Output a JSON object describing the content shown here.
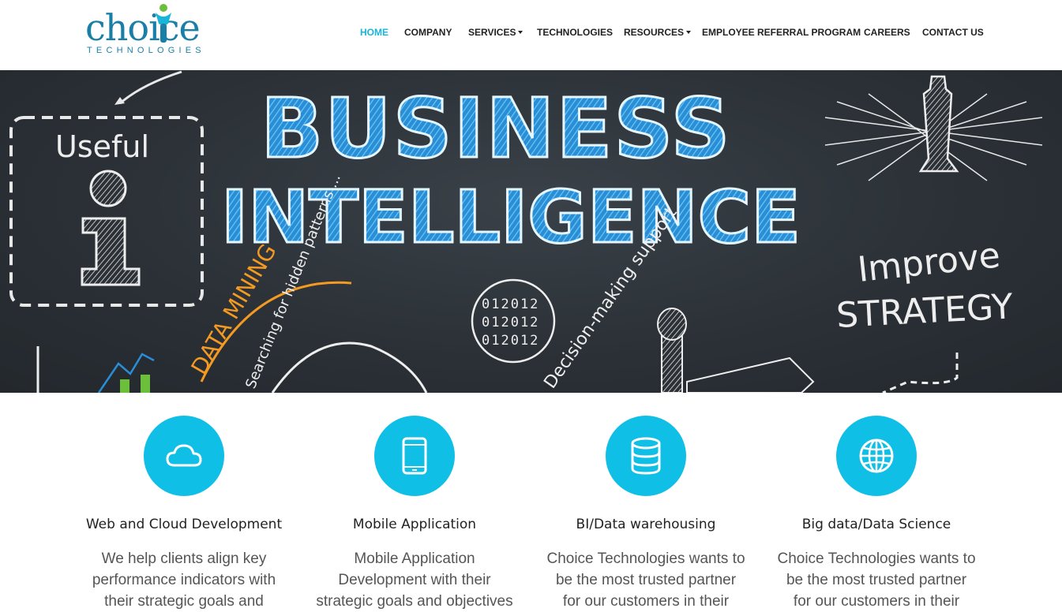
{
  "brand": {
    "name": "choice",
    "tagline": "TECHNOLOGIES",
    "color": "#1a7fa7"
  },
  "nav": {
    "items": [
      {
        "label": "HOME",
        "active": true,
        "dropdown": false
      },
      {
        "label": "COMPANY",
        "active": false,
        "dropdown": false
      },
      {
        "label": "SERVICES",
        "active": false,
        "dropdown": true
      },
      {
        "label": "TECHNOLOGIES",
        "active": false,
        "dropdown": false
      },
      {
        "label": "RESOURCES",
        "active": false,
        "dropdown": true
      },
      {
        "label": "EMPLOYEE REFERRAL PROGRAM",
        "active": false,
        "dropdown": false
      },
      {
        "label": "CAREERS",
        "active": false,
        "dropdown": false
      },
      {
        "label": "CONTACT US",
        "active": false,
        "dropdown": false
      }
    ],
    "active_color": "#1ab4d8"
  },
  "hero": {
    "headline_1": "BUSINESS",
    "headline_2": "INTELLIGENCE",
    "note_useful": "Useful",
    "note_data_mining": "DATA MINING",
    "note_searching": "Searching for hidden patterns ...",
    "note_binary": [
      "012012",
      "012012",
      "012012"
    ],
    "note_decision": "Decision-making support",
    "note_improve": "Improve",
    "note_strategy": "STRATEGY"
  },
  "features": [
    {
      "icon": "cloud-icon",
      "title": "Web and Cloud Development",
      "text": "We help clients align key performance indicators with their strategic goals and"
    },
    {
      "icon": "mobile-icon",
      "title": "Mobile Application",
      "text": "Mobile Application Development with their strategic goals and objectives"
    },
    {
      "icon": "database-icon",
      "title": "BI/Data warehousing",
      "text": "Choice Technologies wants to be the most trusted partner for our customers in their Project"
    },
    {
      "icon": "globe-icon",
      "title": "Big data/Data Science",
      "text": "Choice Technologies wants to be the most trusted partner for our customers in their Project"
    }
  ],
  "colors": {
    "accent": "#0fbfe6",
    "hero_bg": "#2b3137"
  }
}
